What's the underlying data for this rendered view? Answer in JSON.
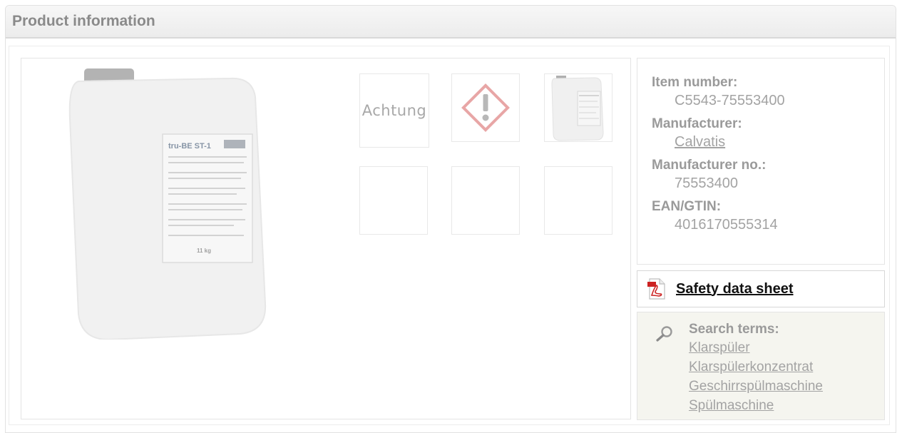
{
  "panel": {
    "title": "Product information"
  },
  "gallery": {
    "main_image_label": "tru-BE ST-1",
    "main_image_weight": "11 kg",
    "thumbnails": [
      {
        "type": "text",
        "text": "Achtung"
      },
      {
        "type": "icon",
        "icon": "ghs-exclamation-icon"
      },
      {
        "type": "image",
        "icon": "product-canister-thumbnail"
      },
      {
        "type": "empty"
      },
      {
        "type": "empty"
      },
      {
        "type": "empty"
      }
    ]
  },
  "info": {
    "item_number_label": "Item number:",
    "item_number": "C5543-75553400",
    "manufacturer_label": "Manufacturer:",
    "manufacturer": "Calvatis",
    "manufacturer_no_label": "Manufacturer no.:",
    "manufacturer_no": "75553400",
    "ean_label": "EAN/GTIN:",
    "ean": "4016170555314"
  },
  "safety": {
    "label": "Safety data sheet",
    "icon": "pdf-icon"
  },
  "search": {
    "title": "Search terms:",
    "icon": "search-icon",
    "terms": [
      "Klarspüler",
      "Klarspülerkonzentrat",
      "Geschirrspülmaschine",
      "Spülmaschine"
    ]
  },
  "colors": {
    "ghs_red": "#e8a6a6",
    "pdf_red": "#cc2222",
    "search_bg": "#f5f5ef"
  }
}
